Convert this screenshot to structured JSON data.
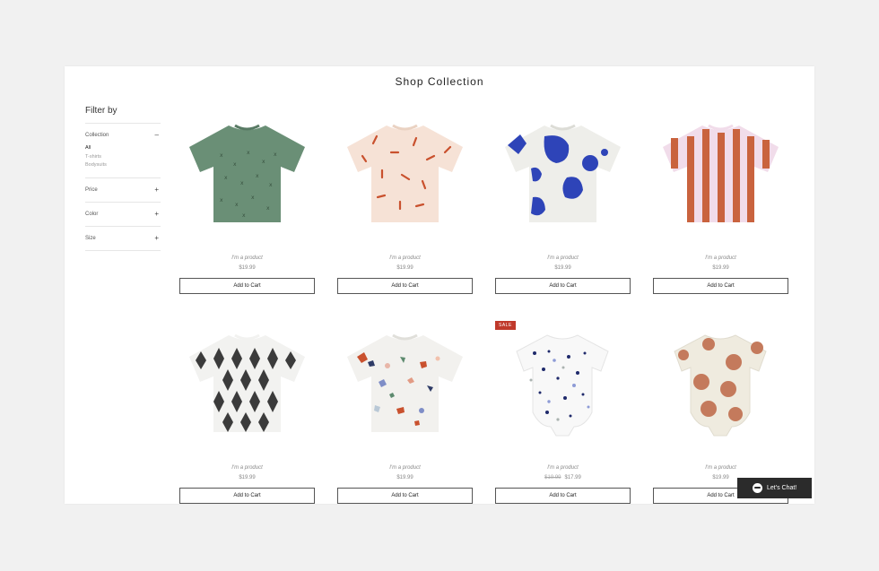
{
  "page": {
    "title": "Shop Collection"
  },
  "filters": {
    "heading": "Filter by",
    "collection": {
      "label": "Collection",
      "toggle": "–",
      "options": [
        "All",
        "T-shirts",
        "Bodysuits"
      ]
    },
    "price": {
      "label": "Price",
      "toggle": "+"
    },
    "color": {
      "label": "Color",
      "toggle": "+"
    },
    "size": {
      "label": "Size",
      "toggle": "+"
    }
  },
  "products": [
    {
      "name": "I'm a product",
      "price": "$19.99",
      "button": "Add to Cart",
      "icon": "green-tshirt"
    },
    {
      "name": "I'm a product",
      "price": "$19.99",
      "button": "Add to Cart",
      "icon": "peach-dash-tshirt"
    },
    {
      "name": "I'm a product",
      "price": "$19.99",
      "button": "Add to Cart",
      "icon": "blue-blob-tshirt"
    },
    {
      "name": "I'm a product",
      "price": "$19.99",
      "button": "Add to Cart",
      "icon": "striped-tshirt"
    },
    {
      "name": "I'm a product",
      "price": "$19.99",
      "button": "Add to Cart",
      "icon": "diamond-tshirt"
    },
    {
      "name": "I'm a product",
      "price": "$19.99",
      "button": "Add to Cart",
      "icon": "terrazzo-tshirt"
    },
    {
      "name": "I'm a product",
      "price": "$17.99",
      "old_price": "$19.99",
      "badge": "SALE",
      "button": "Add to Cart",
      "icon": "terrazzo-bodysuit"
    },
    {
      "name": "I'm a product",
      "price": "$19.99",
      "button": "Add to Cart",
      "icon": "polka-dot-bodysuit"
    }
  ],
  "chat": {
    "label": "Let's Chat!"
  },
  "colors": {
    "background": "#f1f1f1",
    "sale": "#c0392b",
    "chat": "#2b2b2b"
  }
}
